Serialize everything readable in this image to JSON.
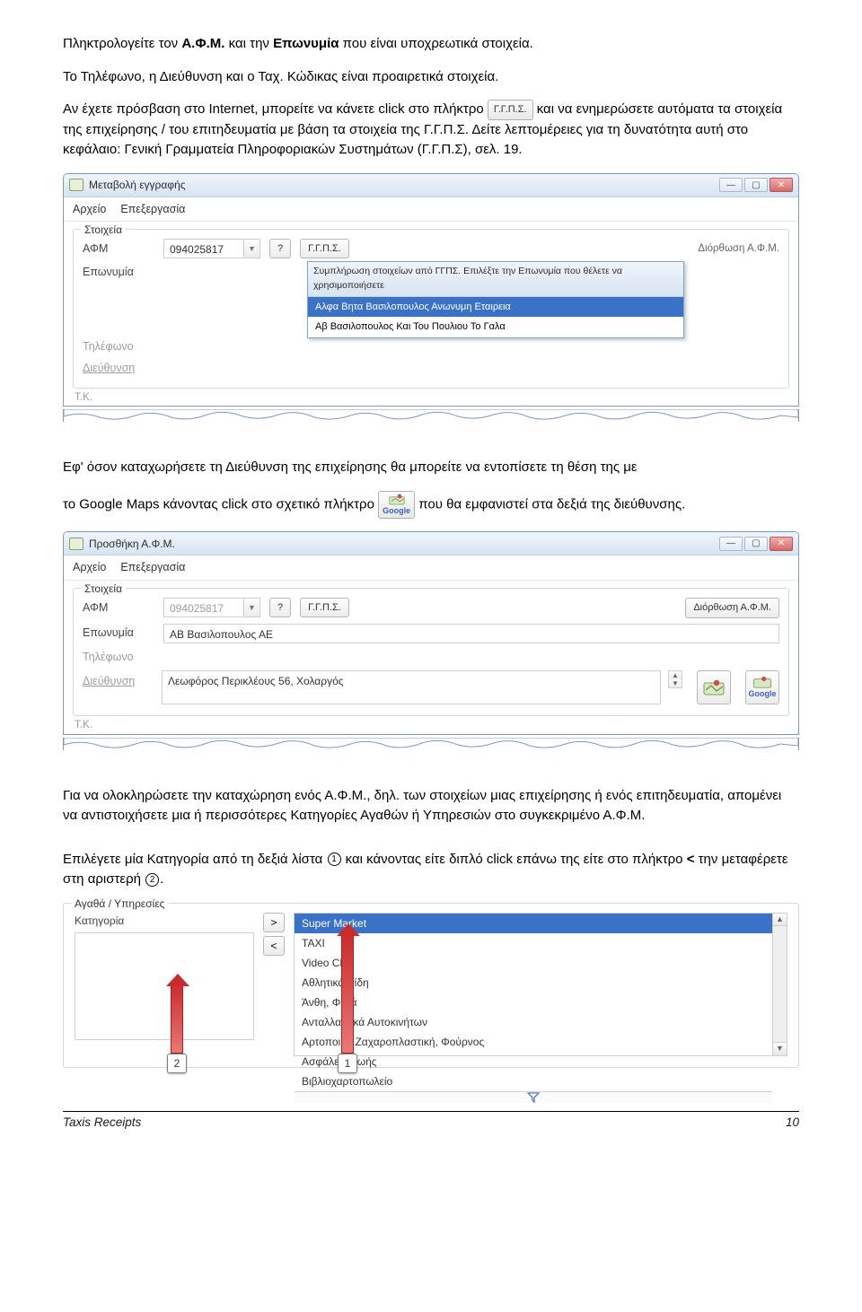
{
  "intro": {
    "p1a": "Πληκτρολογείτε τον ",
    "p1b": "Α.Φ.Μ.",
    "p1c": " και την ",
    "p1d": "Επωνυμία",
    "p1e": " που είναι υποχρεωτικά στοιχεία."
  },
  "p2": "Το Τηλέφωνο, η Διεύθυνση και ο Ταχ. Κώδικας είναι προαιρετικά στοιχεία.",
  "p3a": "Αν έχετε πρόσβαση στο Internet, μπορείτε να κάνετε click στο πλήκτρο ",
  "p3_btn": "Γ.Γ.Π.Σ.",
  "p3b": " και να ενημερώσετε αυτόματα τα στοιχεία της επιχείρησης / του επιτηδευματία με βάση τα στοιχεία της Γ.Γ.Π.Σ. Δείτε λεπτομέρειες για τη δυνατότητα αυτή στο κεφάλαιο: Γενική Γραμματεία Πληροφοριακών Συστημάτων (Γ.Γ.Π.Σ), σελ. 19.",
  "win1": {
    "title": "Μεταβολή εγγραφής",
    "menu1": "Αρχείο",
    "menu2": "Επεξεργασία",
    "group": "Στοιχεία",
    "lbl_afm": "ΑΦΜ",
    "val_afm": "094025817",
    "btn_q": "?",
    "btn_ggps": "Γ.Γ.Π.Σ.",
    "btn_right_partial": "Διόρθωση Α.Φ.Μ.",
    "lbl_eponymia": "Επωνυμία",
    "lbl_til": "Τηλέφωνο",
    "lbl_dieu": "Διεύθυνση",
    "lbl_tk": "Τ.Κ.",
    "dd_header": "Συμπλήρωση στοιχείων από ΓΓΠΣ. Επιλέξτε την Επωνυμία που θέλετε να χρησιμοποιήσετε",
    "dd_item1": "Αλφα Βητα Βασιλοπουλος Ανωνυμη Εταιρεια",
    "dd_item2": "Αβ Βασιλοπουλος Και Του Πουλιου Το Γαλα"
  },
  "p4": "Εφ' όσον καταχωρήσετε τη Διεύθυνση της επιχείρησης θα μπορείτε να εντοπίσετε τη θέση της με",
  "p5a": "το Google Maps κάνοντας click στο σχετικό πλήκτρο ",
  "p5b": " που θα εμφανιστεί στα δεξιά της διεύθυνσης.",
  "google_label": "Google",
  "win2": {
    "title": "Προσθήκη Α.Φ.Μ.",
    "menu1": "Αρχείο",
    "menu2": "Επεξεργασία",
    "group": "Στοιχεία",
    "lbl_afm": "ΑΦΜ",
    "val_afm": "094025817",
    "btn_q": "?",
    "btn_ggps": "Γ.Γ.Π.Σ.",
    "btn_right": "Διόρθωση Α.Φ.Μ.",
    "lbl_eponymia": "Επωνυμία",
    "val_eponymia": "ΑΒ Βασιλοπουλος ΑΕ",
    "lbl_til": "Τηλέφωνο",
    "lbl_dieu": "Διεύθυνση",
    "val_dieu": "Λεωφόρος Περικλέους 56, Χολαργός",
    "lbl_tk": "Τ.Κ."
  },
  "p6": "Για να ολοκληρώσετε την καταχώρηση ενός Α.Φ.Μ., δηλ. των στοιχείων μιας επιχείρησης ή ενός επιτηδευματία, απομένει να αντιστοιχήσετε μια ή περισσότερες Κατηγορίες Αγαθών ή Υπηρεσιών στο συγκεκριμένο Α.Φ.Μ.",
  "p7a": "Επιλέγετε μία Κατηγορία από τη δεξιά λίστα ",
  "p7b": " και κάνοντας είτε διπλό click επάνω της είτε στο πλήκτρο ",
  "p7c": "<",
  "p7d": " την μεταφέρετε στη αριστερή ",
  "p7e": ".",
  "goods": {
    "group": "Αγαθά / Υπηρεσίες",
    "lbl_cat": "Κατηγορία",
    "btn_right": ">",
    "btn_left": "<",
    "items": [
      "Super Market",
      "TAXI",
      "Video Club",
      "Αθλητικά Είδη",
      "Άνθη, Φυτά",
      "Ανταλλακτικά Αυτοκινήτων",
      "Αρτοποιία, Ζαχαροπλαστική, Φούρνος",
      "Ασφάλεια Ζωής",
      "Βιβλιοχαρτοπωλείο"
    ],
    "badge1": "1",
    "badge2": "2"
  },
  "footer": {
    "left": "Taxis Receipts",
    "right": "10"
  }
}
